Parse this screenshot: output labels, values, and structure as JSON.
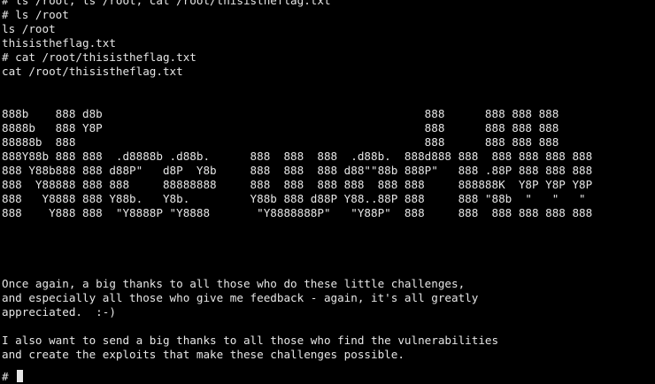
{
  "terminal": {
    "lines": [
      "# ls /root; ls /root; cat /root/thisistheflag.txt",
      "# ls /root",
      "ls /root",
      "thisistheflag.txt",
      "# cat /root/thisistheflag.txt",
      "cat /root/thisistheflag.txt",
      "",
      "",
      "888b    888 d8b                                                888      888 888 888",
      "8888b   888 Y8P                                                888      888 888 888",
      "88888b  888                                                    888      888 888 888",
      "888Y88b 888 888  .d8888b .d88b.      888  888  888  .d88b.  888d888 888  888 888 888 888",
      "888 Y88b888 888 d88P\"   d8P  Y8b     888  888  888 d88\"\"88b 888P\"   888 .88P 888 888 888",
      "888  Y88888 888 888     88888888     888  888  888 888  888 888     888888K  Y8P Y8P Y8P",
      "888   Y8888 888 Y88b.   Y8b.         Y88b 888 d88P Y88..88P 888     888 \"88b  \"   \"   \"",
      "888    Y888 888  \"Y8888P \"Y8888       \"Y8888888P\"   \"Y88P\"  888     888  888 888 888 888",
      "",
      "",
      "",
      "",
      "Once again, a big thanks to all those who do these little challenges,",
      "and especially all those who give me feedback - again, it's all greatly",
      "appreciated.  :-)",
      "",
      "I also want to send a big thanks to all those who find the vulnerabilities",
      "and create the exploits that make these challenges possible.",
      ""
    ],
    "prompt": "#"
  }
}
